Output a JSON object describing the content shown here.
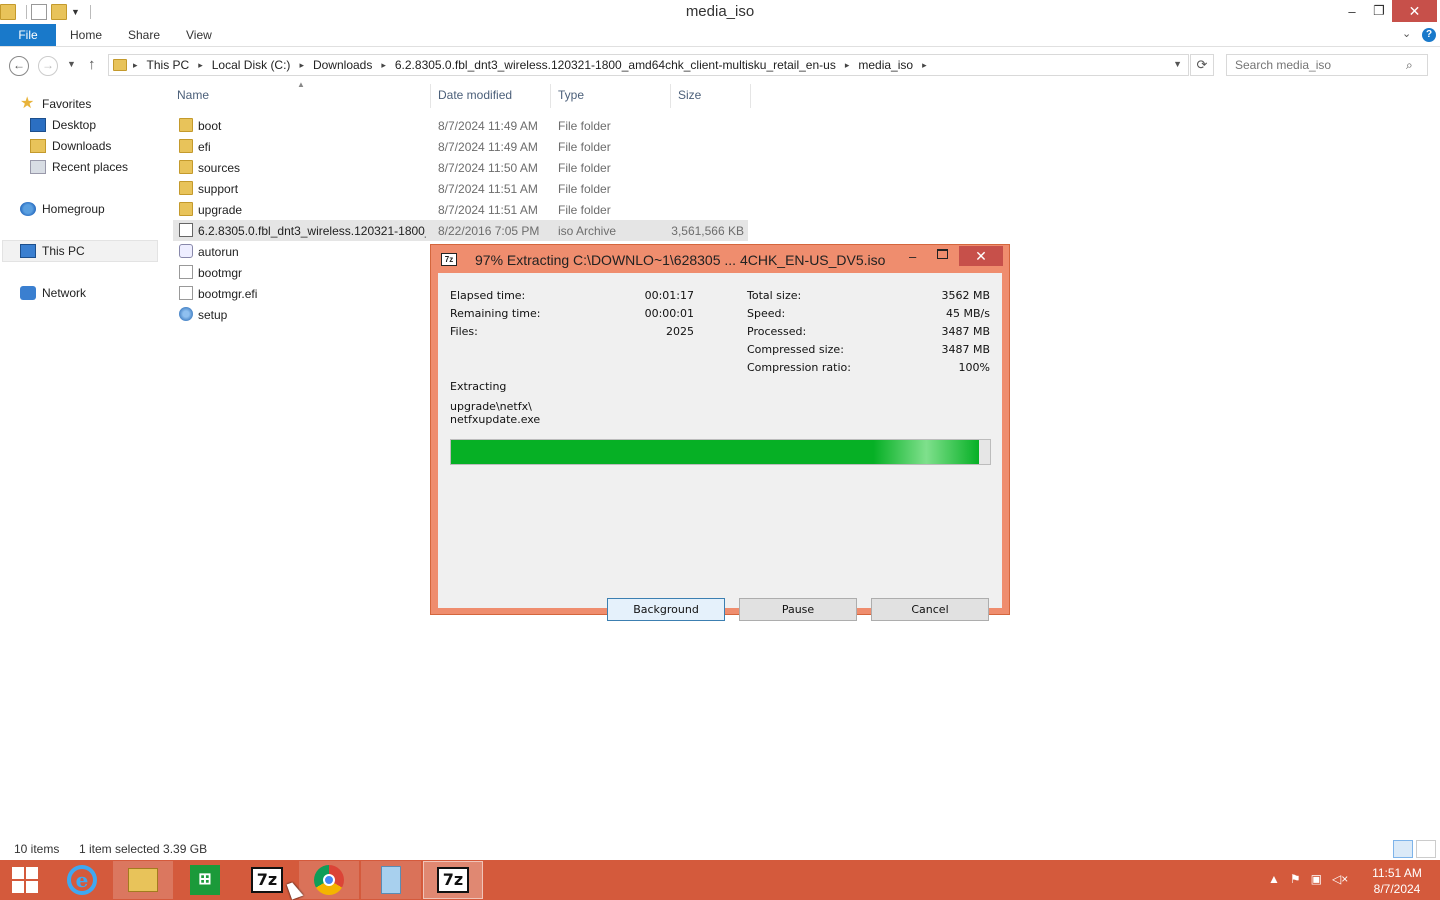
{
  "window": {
    "title": "media_iso",
    "minimize_label": "–",
    "maximize_label": "❐",
    "close_label": "✕"
  },
  "ribbon": {
    "tabs": [
      "File",
      "Home",
      "Share",
      "View"
    ]
  },
  "address": {
    "crumbs": [
      "This PC",
      "Local Disk (C:)",
      "Downloads",
      "6.2.8305.0.fbl_dnt3_wireless.120321-1800_amd64chk_client-multisku_retail_en-us",
      "media_iso"
    ],
    "search_placeholder": "Search media_iso"
  },
  "navpane": {
    "favorites": "Favorites",
    "desktop": "Desktop",
    "downloads": "Downloads",
    "recent": "Recent places",
    "homegroup": "Homegroup",
    "thispc": "This PC",
    "network": "Network"
  },
  "columns": {
    "name": "Name",
    "date": "Date modified",
    "type": "Type",
    "size": "Size"
  },
  "files": [
    {
      "name": "boot",
      "date": "8/7/2024 11:49 AM",
      "type": "File folder",
      "size": "",
      "icon": "folder-icon"
    },
    {
      "name": "efi",
      "date": "8/7/2024 11:49 AM",
      "type": "File folder",
      "size": "",
      "icon": "folder-icon"
    },
    {
      "name": "sources",
      "date": "8/7/2024 11:50 AM",
      "type": "File folder",
      "size": "",
      "icon": "folder-icon"
    },
    {
      "name": "support",
      "date": "8/7/2024 11:51 AM",
      "type": "File folder",
      "size": "",
      "icon": "folder-icon"
    },
    {
      "name": "upgrade",
      "date": "8/7/2024 11:51 AM",
      "type": "File folder",
      "size": "",
      "icon": "folder-icon"
    },
    {
      "name": "6.2.8305.0.fbl_dnt3_wireless.120321-1800_...",
      "date": "8/22/2016 7:05 PM",
      "type": "iso Archive",
      "size": "3,561,566 KB",
      "icon": "iso-file-icon"
    },
    {
      "name": "autorun",
      "date": "",
      "type": "",
      "size": "",
      "icon": "settings-file-icon"
    },
    {
      "name": "bootmgr",
      "date": "",
      "type": "",
      "size": "",
      "icon": "file-icon"
    },
    {
      "name": "bootmgr.efi",
      "date": "",
      "type": "",
      "size": "",
      "icon": "file-icon"
    },
    {
      "name": "setup",
      "date": "",
      "type": "",
      "size": "",
      "icon": "setup-icon"
    }
  ],
  "status": {
    "count": "10 items",
    "selection": "1 item selected  3.39 GB"
  },
  "dialog": {
    "title": "97% Extracting C:\\DOWNLO~1\\628305 ... 4CHK_EN-US_DV5.iso",
    "app_icon_text": "7z",
    "elapsed_label": "Elapsed time:",
    "elapsed_value": "00:01:17",
    "remaining_label": "Remaining time:",
    "remaining_value": "00:00:01",
    "files_label": "Files:",
    "files_value": "2025",
    "total_label": "Total size:",
    "total_value": "3562 MB",
    "speed_label": "Speed:",
    "speed_value": "45 MB/s",
    "processed_label": "Processed:",
    "processed_value": "3487 MB",
    "compressed_label": "Compressed size:",
    "compressed_value": "3487 MB",
    "ratio_label": "Compression ratio:",
    "ratio_value": "100%",
    "action_label": "Extracting",
    "current_path": "upgrade\\netfx\\",
    "current_file": "netfxupdate.exe",
    "progress": 0.98,
    "background_label": "Background",
    "pause_label": "Pause",
    "cancel_label": "Cancel"
  },
  "taskbar": {
    "store_label": "⊞",
    "sevenzip_label": "7z",
    "clock_time": "11:51 AM",
    "clock_date": "8/7/2024"
  },
  "colors": {
    "accent": "#1979ca",
    "taskbar": "#d45a3c",
    "dialog_frame": "#ef8d6e",
    "progress": "#06b025"
  }
}
